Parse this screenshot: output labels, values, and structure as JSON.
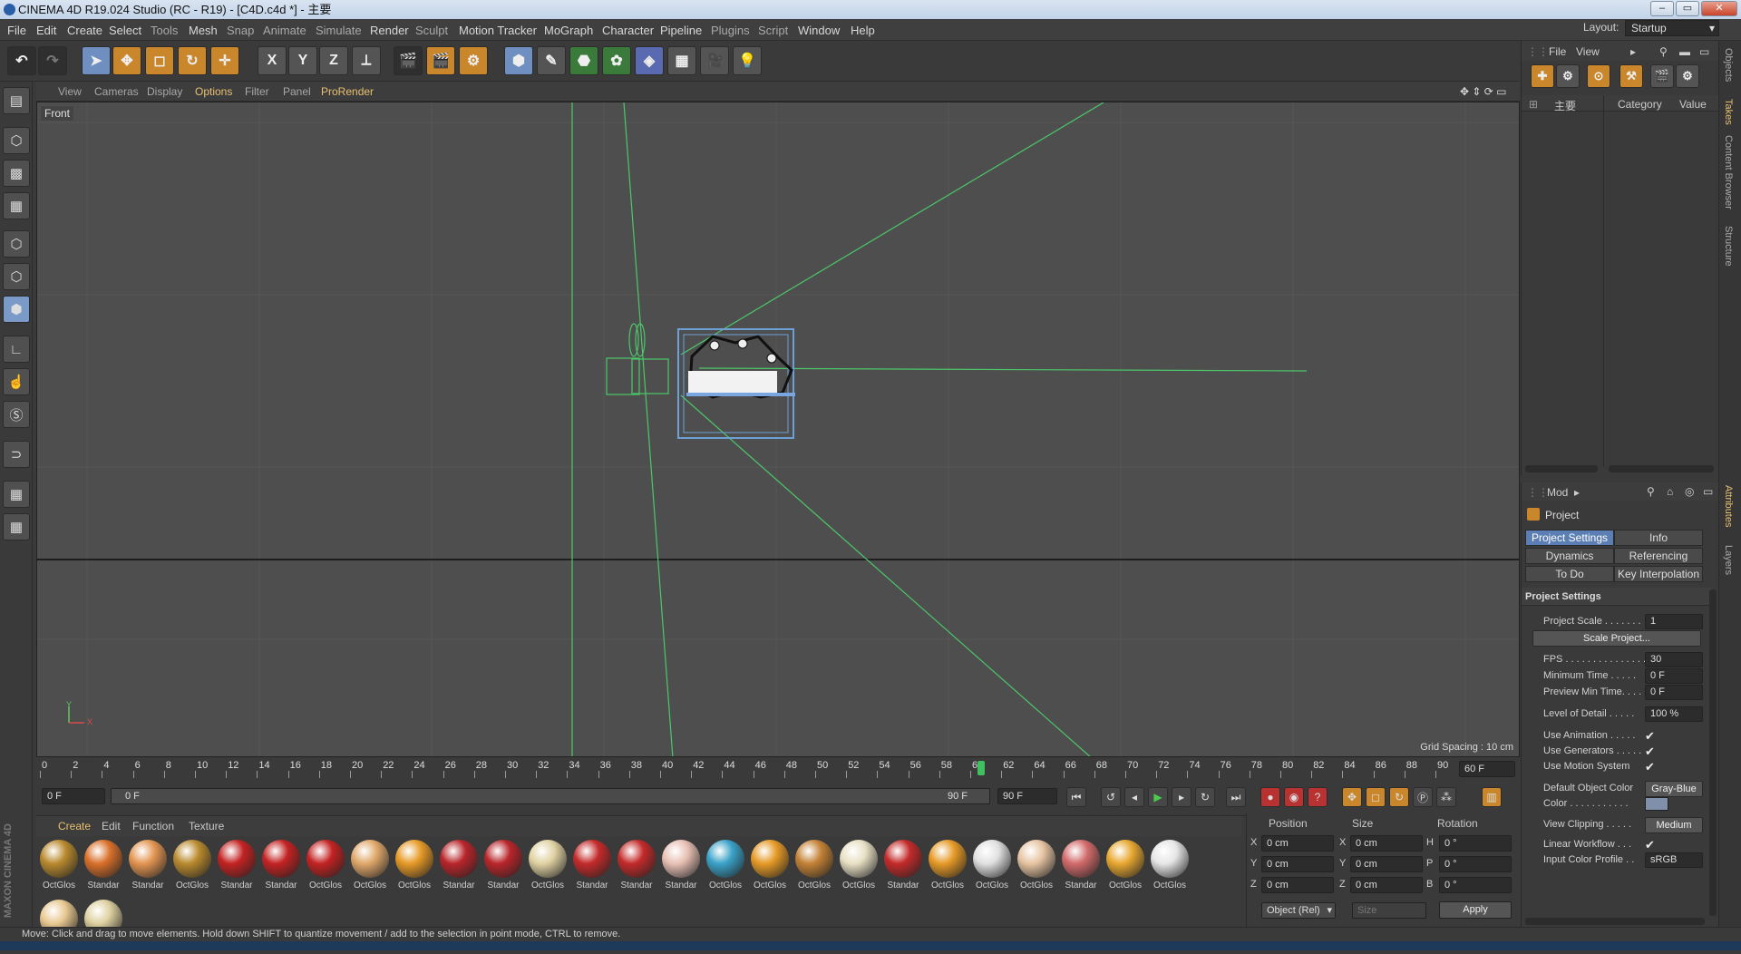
{
  "title": "CINEMA 4D R19.024 Studio (RC - R19) - [C4D.c4d *] - 主要",
  "menu": [
    "File",
    "Edit",
    "Create",
    "Select",
    "Tools",
    "Mesh",
    "Snap",
    "Animate",
    "Simulate",
    "Render",
    "Sculpt",
    "Motion Tracker",
    "MoGraph",
    "Character",
    "Pipeline",
    "Plugins",
    "Script",
    "Window",
    "Help"
  ],
  "layout": {
    "label": "Layout:",
    "value": "Startup"
  },
  "toolbar": {
    "x": "X",
    "y": "Y",
    "z": "Z"
  },
  "viewport": {
    "menu": [
      "View",
      "Cameras",
      "Display",
      "Options",
      "Filter",
      "Panel",
      "ProRender"
    ],
    "label": "Front",
    "grid_spacing": "Grid Spacing : 10 cm",
    "axis_y": "Y",
    "axis_x": "X"
  },
  "timeline": {
    "ticks": [
      "0",
      "2",
      "4",
      "6",
      "8",
      "10",
      "12",
      "14",
      "16",
      "18",
      "20",
      "22",
      "24",
      "26",
      "28",
      "30",
      "32",
      "34",
      "36",
      "38",
      "40",
      "42",
      "44",
      "46",
      "48",
      "50",
      "52",
      "54",
      "56",
      "58",
      "60",
      "62",
      "64",
      "66",
      "68",
      "70",
      "72",
      "74",
      "76",
      "78",
      "80",
      "82",
      "84",
      "86",
      "88",
      "90"
    ],
    "current_frame": "60",
    "current_field": "60 F",
    "start": "0 F",
    "range_start": "0 F",
    "range_end": "90 F",
    "end": "90 F"
  },
  "materials": {
    "menu": [
      "Create",
      "Edit",
      "Function",
      "Texture"
    ],
    "items": [
      {
        "name": "OctGlos",
        "color": "#b98a2e"
      },
      {
        "name": "Standar",
        "color": "#d9702a"
      },
      {
        "name": "Standar",
        "color": "#e39552"
      },
      {
        "name": "OctGlos",
        "color": "#b98a2e"
      },
      {
        "name": "Standar",
        "color": "#c42222"
      },
      {
        "name": "Standar",
        "color": "#c42222"
      },
      {
        "name": "OctGlos",
        "color": "#c42222"
      },
      {
        "name": "OctGlos",
        "color": "#e0a86a"
      },
      {
        "name": "OctGlos",
        "color": "#e69a26"
      },
      {
        "name": "Standar",
        "color": "#b8252a"
      },
      {
        "name": "Standar",
        "color": "#b8252a"
      },
      {
        "name": "OctGlos",
        "color": "#e0d2a2"
      },
      {
        "name": "Standar",
        "color": "#c42a2a"
      },
      {
        "name": "Standar",
        "color": "#c42a2a"
      },
      {
        "name": "Standar",
        "color": "#e8c0b4"
      },
      {
        "name": "OctGlos",
        "color": "#3aa2c8"
      },
      {
        "name": "OctGlos",
        "color": "#e69a26"
      },
      {
        "name": "OctGlos",
        "color": "#c48236"
      },
      {
        "name": "OctGlos",
        "color": "#e8e0c4"
      },
      {
        "name": "Standar",
        "color": "#c42a2a"
      },
      {
        "name": "OctGlos",
        "color": "#e69a26"
      },
      {
        "name": "OctGlos",
        "color": "#e0e0e0"
      },
      {
        "name": "OctGlos",
        "color": "#e6c4a2"
      },
      {
        "name": "Standar",
        "color": "#d26a6a"
      },
      {
        "name": "OctGlos",
        "color": "#e8a830"
      },
      {
        "name": "OctGlos",
        "color": "#e6e6e6"
      },
      {
        "name": "",
        "color": "#e8c890"
      },
      {
        "name": "",
        "color": "#ddd0a0"
      }
    ]
  },
  "coords": {
    "headers": [
      "Position",
      "Size",
      "Rotation"
    ],
    "rows": [
      {
        "a": "X",
        "pos": "0 cm",
        "b": "X",
        "size": "0 cm",
        "c": "H",
        "rot": "0 °"
      },
      {
        "a": "Y",
        "pos": "0 cm",
        "b": "Y",
        "size": "0 cm",
        "c": "P",
        "rot": "0 °"
      },
      {
        "a": "Z",
        "pos": "0 cm",
        "b": "Z",
        "size": "0 cm",
        "c": "B",
        "rot": "0 °"
      }
    ],
    "mode": "Object (Rel)",
    "size_mode": "Size",
    "apply": "Apply"
  },
  "objects": {
    "menu": [
      "File",
      "View"
    ],
    "root": "主要",
    "columns": [
      "Category",
      "Value"
    ]
  },
  "attributes": {
    "mode": "Mod",
    "object": "Project",
    "tabs": [
      "Project Settings",
      "Info",
      "Dynamics",
      "Referencing",
      "To Do",
      "Key Interpolation"
    ],
    "section": "Project Settings",
    "props": [
      {
        "label": "Project Scale . . . . . . .",
        "value": "1"
      },
      {
        "label": "Scale Project...",
        "button": true
      },
      {
        "label": "FPS . . . . . . . . . . . . . . .",
        "value": "30"
      },
      {
        "label": "Minimum Time . . . . .",
        "value": "0 F"
      },
      {
        "label": "Preview Min Time. . . .",
        "value": "0 F"
      },
      {
        "label": "Level of Detail . . . . .",
        "value": "100 %"
      },
      {
        "label": "Use Animation . . . . .",
        "check": "✔"
      },
      {
        "label": "Use Generators . . . . .",
        "check": "✔"
      },
      {
        "label": "Use Motion System",
        "check": "✔"
      },
      {
        "label": "Default Object Color",
        "btn": "Gray-Blue"
      },
      {
        "label": "Color . . . . . . . . . . .",
        "swatch": "#8090aa"
      },
      {
        "label": "View Clipping . . . . .",
        "btn": "Medium"
      },
      {
        "label": "Linear Workflow . . .",
        "check": "✔"
      },
      {
        "label": "Input Color Profile . .",
        "value": "sRGB"
      }
    ]
  },
  "side_tabs": [
    "Objects",
    "Takes",
    "Content Browser",
    "Structure",
    "Attributes",
    "Layers"
  ],
  "status": "Move: Click and drag to move elements. Hold down SHIFT to quantize movement / add to the selection in point mode, CTRL to remove."
}
